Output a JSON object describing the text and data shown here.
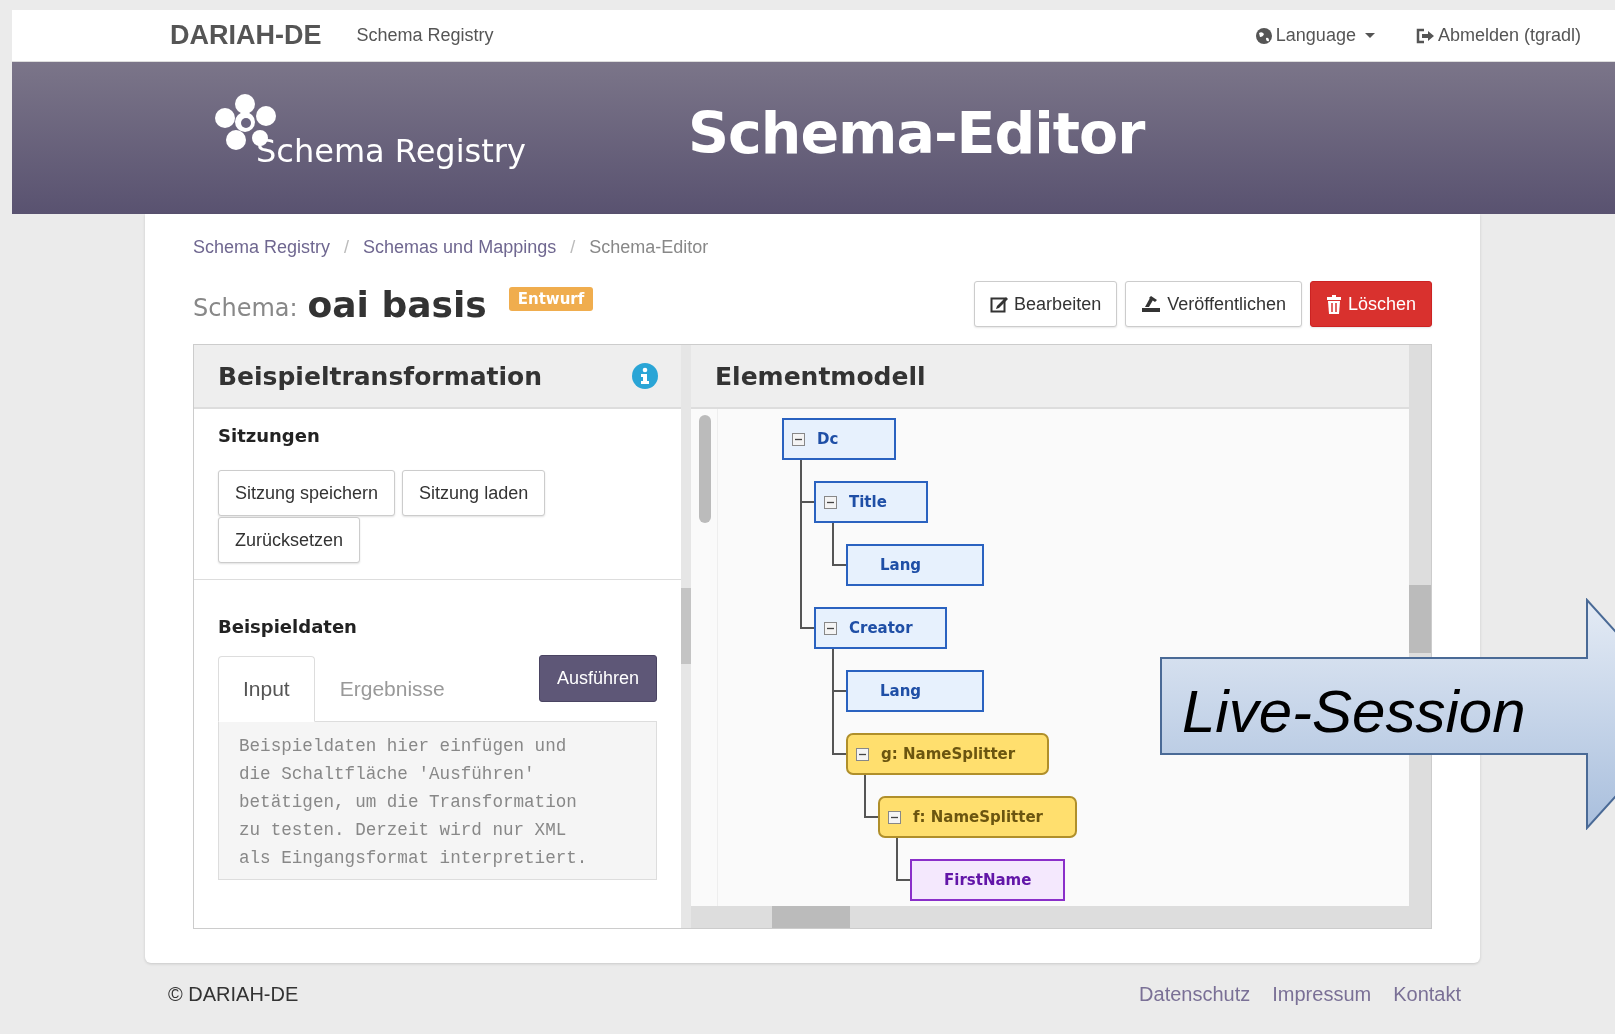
{
  "navbar": {
    "brand": "DARIAH-DE",
    "app": "Schema Registry",
    "language": "Language",
    "logout": "Abmelden (tgradl)"
  },
  "header": {
    "logo_text": "Schema Registry",
    "title": "Schema-Editor"
  },
  "breadcrumb": [
    {
      "label": "Schema Registry",
      "current": false
    },
    {
      "separator": "/",
      "label": "Schemas und Mappings",
      "current": false
    },
    {
      "separator": "/",
      "label": "Schema-Editor",
      "current": true
    }
  ],
  "schema": {
    "label": "Schema:",
    "name": "oai basis",
    "status": "Entwurf"
  },
  "actions": [
    {
      "kind": "edit",
      "label": "Bearbeiten"
    },
    {
      "kind": "publish",
      "label": "Veröffentlichen"
    },
    {
      "kind": "delete",
      "label": "Löschen"
    }
  ],
  "left_panel": {
    "title": "Beispieltransformation",
    "sessions": {
      "heading": "Sitzungen",
      "buttons": [
        "Sitzung speichern",
        "Sitzung laden",
        "Zurücksetzen"
      ]
    },
    "sample": {
      "heading": "Beispieldaten",
      "tabs": [
        {
          "label": "Input",
          "selected": true
        },
        {
          "label": "Ergebnisse",
          "selected": false
        }
      ],
      "run": "Ausführen",
      "placeholder": "Beispieldaten hier einfügen und die Schaltfläche 'Ausführen' betätigen, um die Transformation zu testen. Derzeit wird nur XML als Eingangsformat interpretiert."
    }
  },
  "right_panel": {
    "title": "Elementmodell",
    "tree": [
      {
        "label": "Dc",
        "kind": "element",
        "expanded": true,
        "children": [
          {
            "label": "Title",
            "kind": "element",
            "expanded": true,
            "children": [
              {
                "label": "Lang",
                "kind": "element"
              }
            ]
          },
          {
            "label": "Creator",
            "kind": "element",
            "expanded": true,
            "children": [
              {
                "label": "Lang",
                "kind": "element"
              },
              {
                "label": "g: NameSplitter",
                "kind": "function",
                "expanded": true,
                "children": [
                  {
                    "label": "f: NameSplitter",
                    "kind": "function",
                    "expanded": true,
                    "children": [
                      {
                        "label": "FirstName",
                        "kind": "field"
                      }
                    ]
                  }
                ]
              }
            ]
          }
        ]
      }
    ]
  },
  "callout": {
    "text": "Live-Session"
  },
  "footer": {
    "copyright": "© DARIAH-DE",
    "links": [
      "Datenschutz",
      "Impressum",
      "Kontakt"
    ]
  }
}
